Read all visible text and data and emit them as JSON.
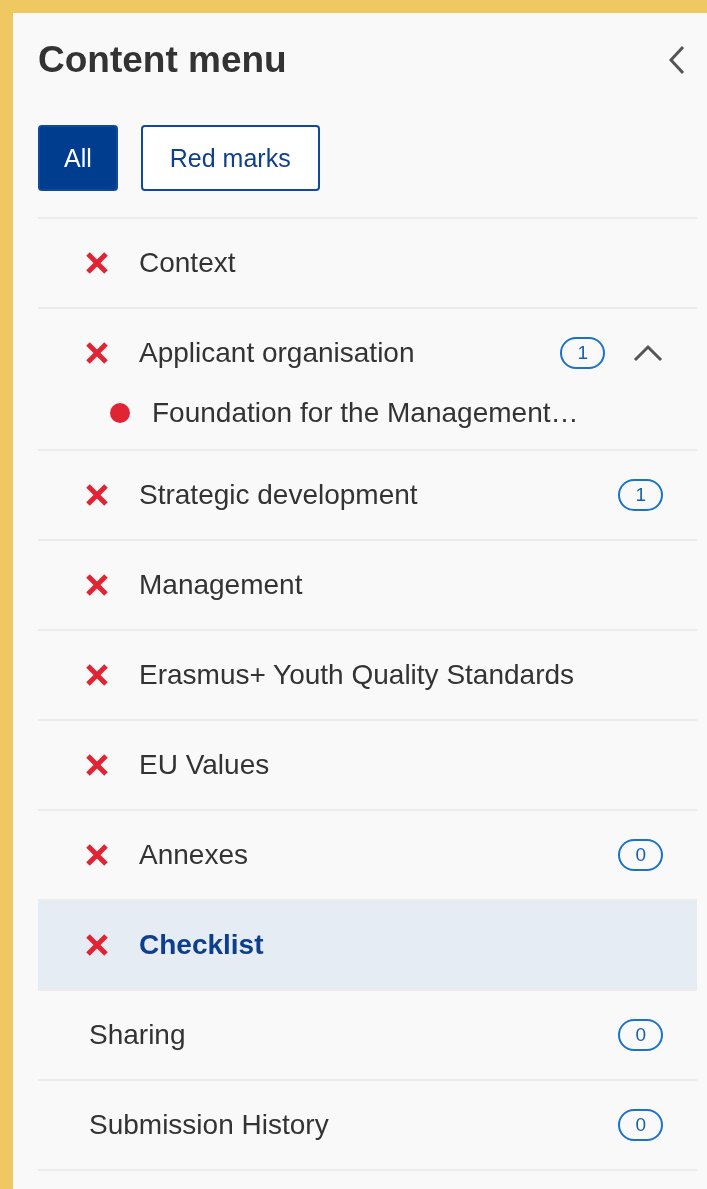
{
  "title": "Content menu",
  "filters": [
    {
      "label": "All",
      "selected": true
    },
    {
      "label": "Red marks",
      "selected": false
    }
  ],
  "items": [
    {
      "kind": "error",
      "label": "Context",
      "selected": false
    },
    {
      "kind": "error",
      "label": "Applicant organisation",
      "badge": "1",
      "expanded": true,
      "selected": false,
      "children": [
        {
          "label": "Foundation for the Management…",
          "color": "#e02434"
        }
      ]
    },
    {
      "kind": "error",
      "label": "Strategic development",
      "badge": "1",
      "selected": false
    },
    {
      "kind": "error",
      "label": "Management",
      "selected": false
    },
    {
      "kind": "error",
      "label": "Erasmus+ Youth Quality Standards",
      "selected": false
    },
    {
      "kind": "error",
      "label": "EU Values",
      "selected": false
    },
    {
      "kind": "error",
      "label": "Annexes",
      "badge": "0",
      "selected": false
    },
    {
      "kind": "error",
      "label": "Checklist",
      "selected": true
    },
    {
      "kind": "plain",
      "label": "Sharing",
      "badge": "0",
      "selected": false
    },
    {
      "kind": "plain",
      "label": "Submission History",
      "badge": "0",
      "selected": false
    }
  ]
}
